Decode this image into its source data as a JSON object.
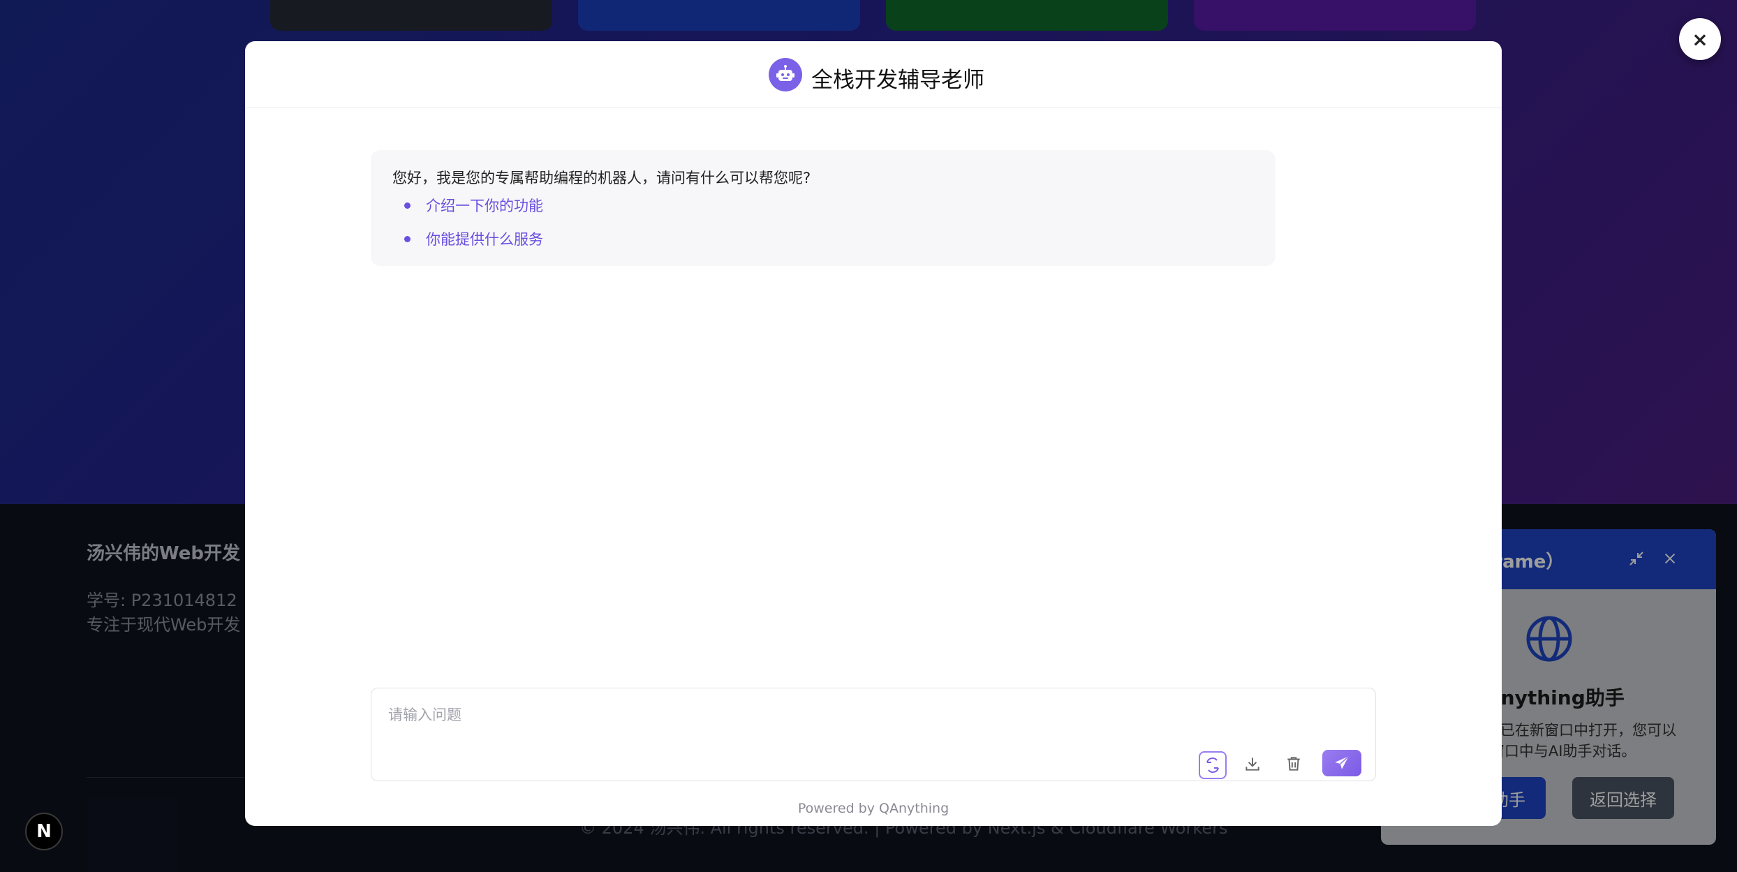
{
  "background": {
    "footer": {
      "site_title": "汤兴伟的Web开发",
      "student_id": "学号: P231014812",
      "tagline": "专注于现代Web开发",
      "copyright": "© 2024 汤兴伟. All rights reserved. | Powered by Next.js & Cloudflare Workers"
    },
    "n_badge": "N",
    "card_colors": [
      "#262b36",
      "#1b3fbf",
      "#0f6b2a",
      "#5a1aa6"
    ]
  },
  "side_panel": {
    "title": "frame）",
    "assistant_name": "Anything助手",
    "desc_line1": "手已在新窗口中打开，您可以",
    "desc_line2": "l窗口中与AI助手对话。",
    "open_button": "开助手",
    "back_button": "返回选择",
    "colors": {
      "header": "#1d45c4",
      "open": "#1d45c4",
      "back": "#4b5563"
    }
  },
  "modal": {
    "title": "全栈开发辅导老师",
    "greeting": "您好，我是您的专属帮助编程的机器人，请问有什么可以帮您呢?",
    "suggestions": [
      "介绍一下你的功能",
      "你能提供什么服务"
    ],
    "input_placeholder": "请输入问题",
    "powered_by": "Powered by QAnything",
    "icons": [
      "robot-icon",
      "recycle-icon",
      "download-icon",
      "trash-icon",
      "send-icon"
    ],
    "accent": "#7b61e8"
  },
  "close_button": "×"
}
